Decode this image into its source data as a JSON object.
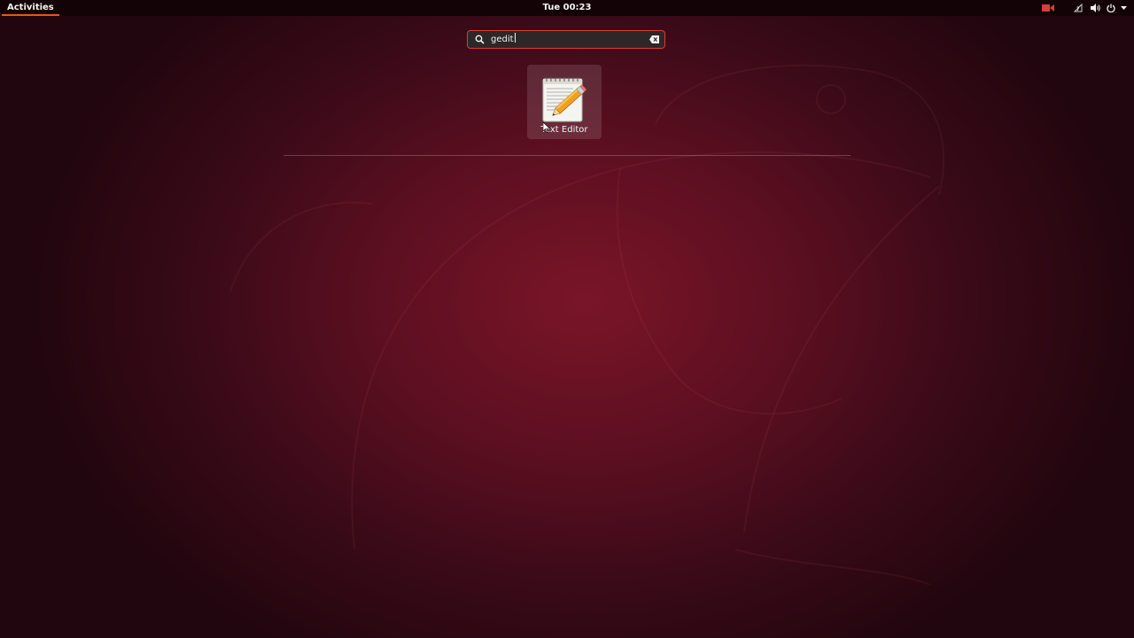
{
  "top_bar": {
    "activities_label": "Activities",
    "clock": "Tue 00:23",
    "tray_icons": [
      "screen-record-icon",
      "network-icon",
      "volume-icon",
      "power-icon",
      "chevron-down-icon"
    ],
    "record_color": "#e03a3a"
  },
  "search": {
    "value": "gedit",
    "focus_color": "#e03a3a"
  },
  "results": [
    {
      "label": "Text Editor",
      "icon": "text-editor-icon"
    }
  ],
  "colors": {
    "accent": "#e95420",
    "wallpaper_center": "#7a1528",
    "wallpaper_edge": "#22060f"
  }
}
